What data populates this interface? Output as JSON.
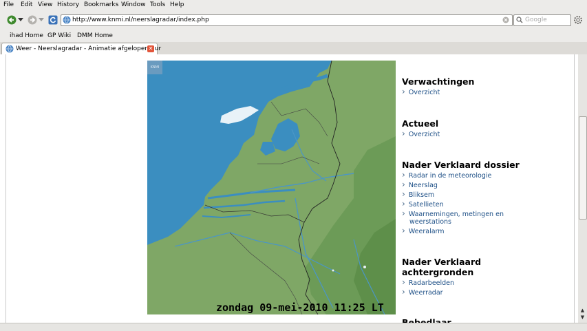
{
  "menubar": [
    "File",
    "Edit",
    "View",
    "History",
    "Bookmarks",
    "Window",
    "Tools",
    "Help"
  ],
  "url": "http://www.knmi.nl/neerslagradar/index.php",
  "search_placeholder": "Google",
  "bookmarks": [
    "ihad Home",
    "GP Wiki",
    "DMM Home"
  ],
  "tab_title": "Weer - Neerslagradar - Animatie afgelopen uur",
  "map": {
    "logo": "KNMI",
    "timestamp": "zondag 09-mei-2010 11:25 LT"
  },
  "sidebar": {
    "sections": [
      {
        "title": "Verwachtingen",
        "links": [
          "Overzicht"
        ]
      },
      {
        "title": "Actueel",
        "links": [
          "Overzicht"
        ]
      },
      {
        "title": "Nader Verklaard dossier",
        "links": [
          "Radar in de meteorologie",
          "Neerslag",
          "Bliksem",
          "Satellieten",
          "Waarnemingen, metingen en",
          "weerstations",
          "Weeralarm"
        ]
      },
      {
        "title": "Nader Verklaard",
        "title2": "achtergronden",
        "links": [
          "Radarbeelden",
          "Weerradar"
        ]
      },
      {
        "title": "Bebedlaar"
      }
    ]
  },
  "colors": {
    "sea": "#3b8ec0",
    "land": "#7fa766",
    "chrome": "#ecebe9",
    "link": "#1d4f86"
  }
}
